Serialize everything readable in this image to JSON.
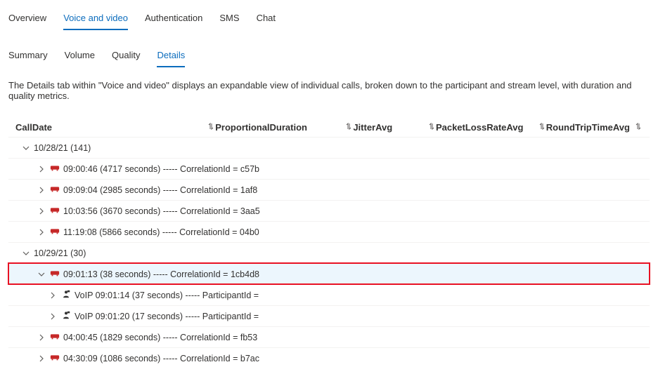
{
  "topTabs": [
    {
      "label": "Overview",
      "active": false
    },
    {
      "label": "Voice and video",
      "active": true
    },
    {
      "label": "Authentication",
      "active": false
    },
    {
      "label": "SMS",
      "active": false
    },
    {
      "label": "Chat",
      "active": false
    }
  ],
  "subTabs": [
    {
      "label": "Summary",
      "active": false
    },
    {
      "label": "Volume",
      "active": false
    },
    {
      "label": "Quality",
      "active": false
    },
    {
      "label": "Details",
      "active": true
    }
  ],
  "description": "The Details tab within \"Voice and video\" displays an expandable view of individual calls, broken down to the participant and stream level, with duration and quality metrics.",
  "columns": [
    {
      "key": "calldate",
      "label": "CallDate"
    },
    {
      "key": "prop",
      "label": "ProportionalDuration"
    },
    {
      "key": "jitter",
      "label": "JitterAvg"
    },
    {
      "key": "pkt",
      "label": "PacketLossRateAvg"
    },
    {
      "key": "rtt",
      "label": "RoundTripTimeAvg"
    }
  ],
  "rows": [
    {
      "type": "group",
      "expanded": true,
      "text": "10/28/21 (141)"
    },
    {
      "type": "call",
      "expanded": false,
      "text": "09:00:46 (4717 seconds) ----- CorrelationId = c57b"
    },
    {
      "type": "call",
      "expanded": false,
      "text": "09:09:04 (2985 seconds) ----- CorrelationId = 1af8"
    },
    {
      "type": "call",
      "expanded": false,
      "text": "10:03:56 (3670 seconds) ----- CorrelationId = 3aa5"
    },
    {
      "type": "call",
      "expanded": false,
      "text": "11:19:08 (5866 seconds) ----- CorrelationId = 04b0"
    },
    {
      "type": "group",
      "expanded": true,
      "text": "10/29/21 (30)"
    },
    {
      "type": "call",
      "expanded": true,
      "selected": true,
      "highlighted": true,
      "text": "09:01:13 (38 seconds) ----- CorrelationId = 1cb4d8"
    },
    {
      "type": "participant",
      "expanded": false,
      "text": "VoIP 09:01:14 (37 seconds) ----- ParticipantId ="
    },
    {
      "type": "participant",
      "expanded": false,
      "text": "VoIP 09:01:20 (17 seconds) ----- ParticipantId ="
    },
    {
      "type": "call",
      "expanded": false,
      "text": "04:00:45 (1829 seconds) ----- CorrelationId = fb53"
    },
    {
      "type": "call",
      "expanded": false,
      "text": "04:30:09 (1086 seconds) ----- CorrelationId = b7ac"
    }
  ]
}
